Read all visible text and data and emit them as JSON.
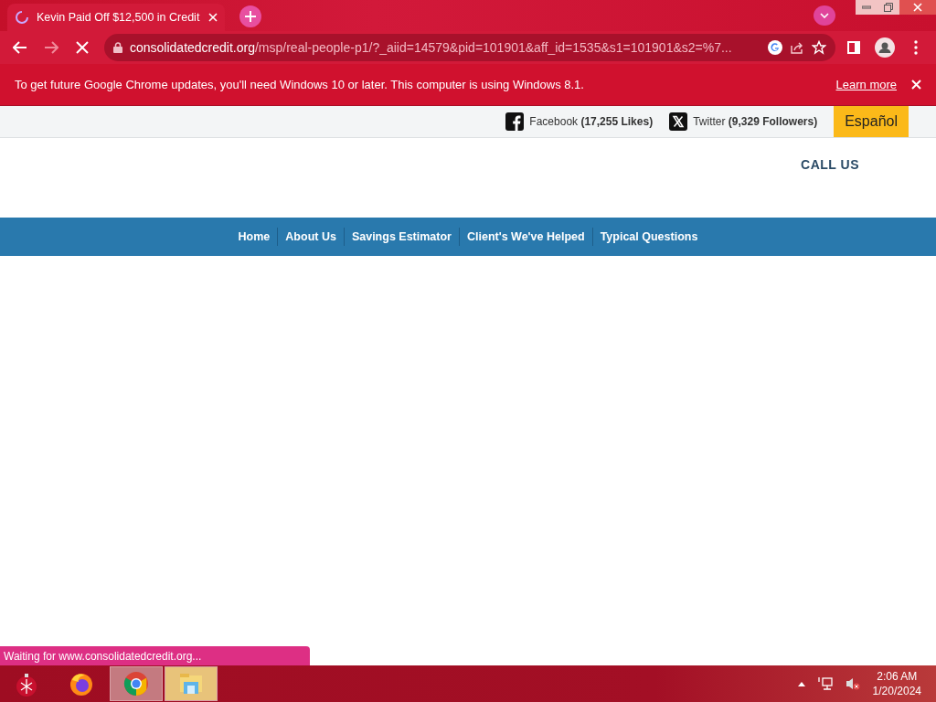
{
  "browser": {
    "tab": {
      "title": "Kevin Paid Off $12,500 in Credit",
      "loading": true
    },
    "url": {
      "host": "consolidatedcredit.org",
      "path": "/msp/real-people-p1/?_aiid=14579&pid=101901&aff_id=1535&s1=101901&s2=%7..."
    },
    "loading": true
  },
  "infobar": {
    "message": "To get future Google Chrome updates, you'll need Windows 10 or later. This computer is using Windows 8.1.",
    "link": "Learn more"
  },
  "site": {
    "social": [
      {
        "kind": "facebook",
        "text": "Facebook **(17,255 Likes)**"
      },
      {
        "kind": "twitter",
        "text": "Twitter **(9,329 Followers)**"
      }
    ],
    "language_button": "Español",
    "call_us": "CALL US",
    "nav": [
      "Home",
      "About Us",
      "Savings Estimator",
      "Client's We've Helped",
      "Typical Questions"
    ]
  },
  "status_bubble": "Waiting for www.consolidatedcredit.org...",
  "taskbar": {
    "apps": [
      {
        "kind": "ornament",
        "selected": false
      },
      {
        "kind": "firefox",
        "selected": false
      },
      {
        "kind": "chrome",
        "selected": true
      },
      {
        "kind": "explorer",
        "selected": true
      }
    ],
    "time": "2:06 AM",
    "date": "1/20/2024"
  }
}
